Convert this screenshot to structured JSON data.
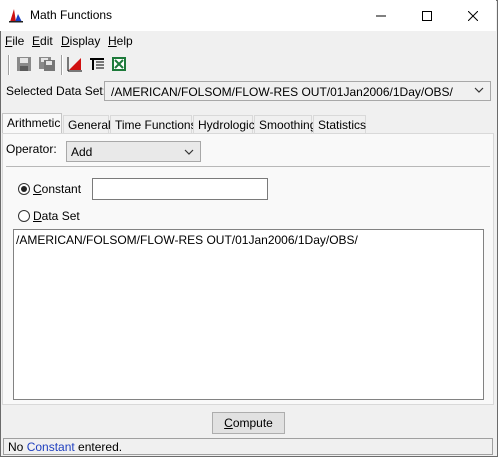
{
  "window": {
    "title": "Math Functions"
  },
  "menu": [
    {
      "mnemonic": "F",
      "rest": "ile"
    },
    {
      "mnemonic": "E",
      "rest": "dit"
    },
    {
      "mnemonic": "D",
      "rest": "isplay"
    },
    {
      "mnemonic": "H",
      "rest": "elp"
    }
  ],
  "toolbar": {
    "icons": [
      "save-icon",
      "save-as-icon",
      "plot-icon",
      "tabulate-icon",
      "excel-icon"
    ]
  },
  "selected_data_set": {
    "label": "Selected Data Set:",
    "value": "/AMERICAN/FOLSOM/FLOW-RES OUT/01Jan2006/1Day/OBS/"
  },
  "tabs": [
    "Arithmetic",
    "General",
    "Time Functions",
    "Hydrologic",
    "Smoothing",
    "Statistics"
  ],
  "active_tab": "Arithmetic",
  "operator": {
    "label": "Operator:",
    "value": "Add"
  },
  "constant": {
    "label_mnemonic": "C",
    "label_rest": "onstant",
    "selected": true,
    "value": ""
  },
  "data_set": {
    "label_mnemonic": "D",
    "label_rest": "ata Set",
    "selected": false,
    "items": [
      "/AMERICAN/FOLSOM/FLOW-RES OUT/01Jan2006/1Day/OBS/"
    ]
  },
  "compute": {
    "mnemonic": "C",
    "rest": "ompute"
  },
  "status": {
    "prefix": "No ",
    "highlight": "Constant",
    "suffix": " entered."
  },
  "colors": {
    "status_highlight": "#1f3fbf",
    "panel_bg": "#f9f9f9",
    "window_bg": "#f0f0f0"
  }
}
